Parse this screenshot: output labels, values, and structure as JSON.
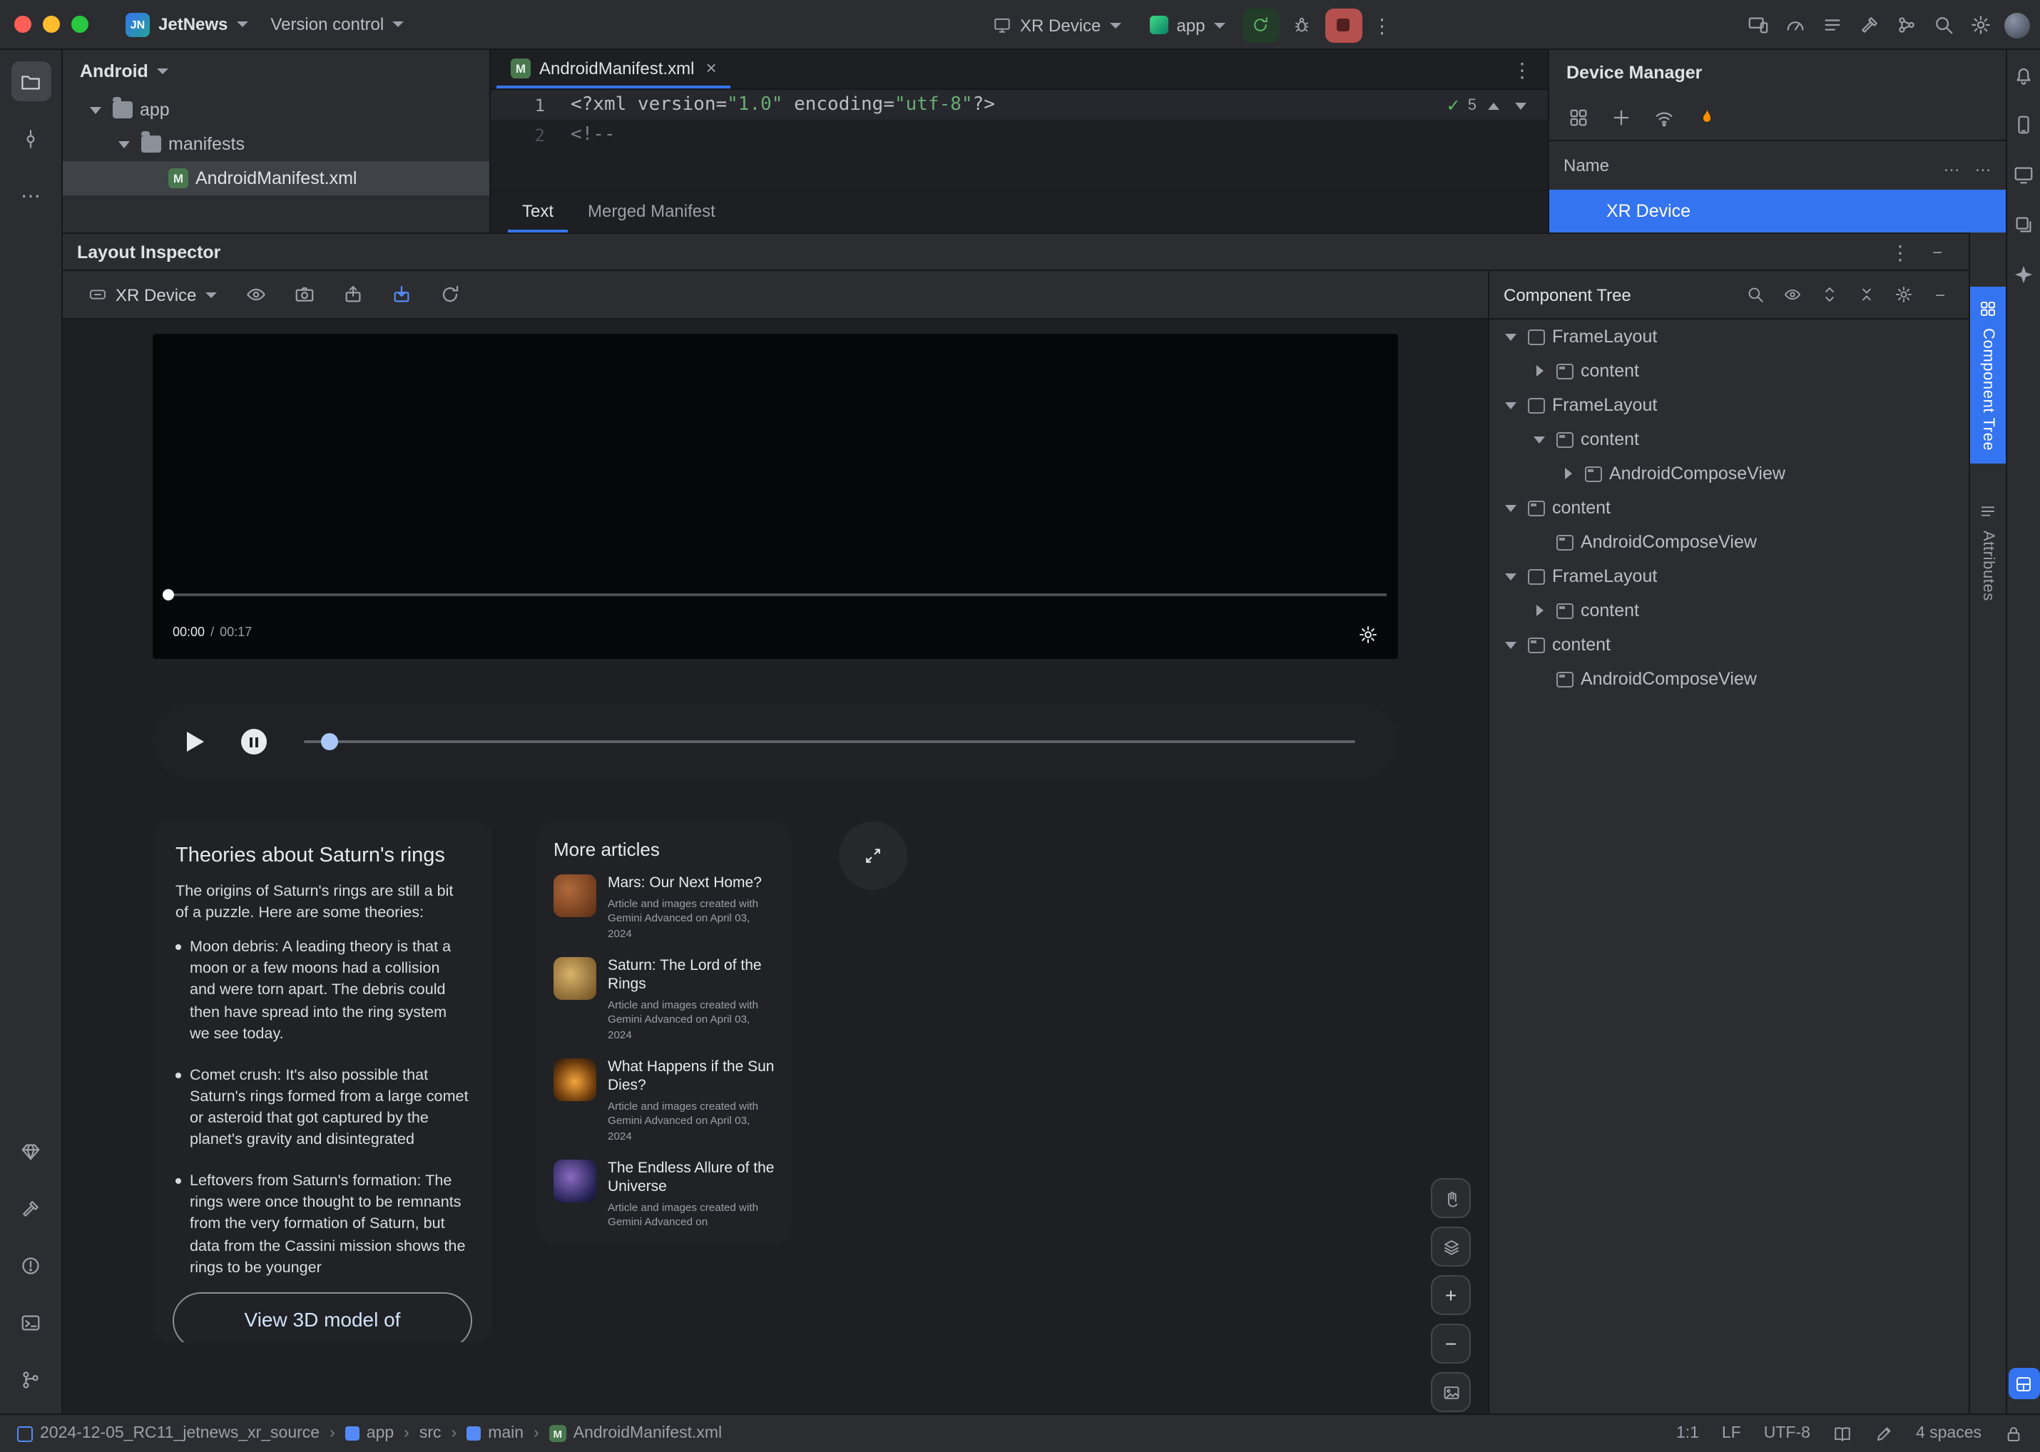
{
  "colors": {
    "accent": "#3574F0",
    "run_green": "#5FB865",
    "stop_red": "#B4504D",
    "string_green": "#6AAB73",
    "firebase_orange": "#FF8F00",
    "selection_blue": "#3574F0"
  },
  "icons": {
    "kebab": "⋮",
    "meatball": "⋯",
    "close": "×",
    "manifest_badge": "M",
    "check": "✓",
    "breadcrumb_separator": "›",
    "plus": "+",
    "minus": "−"
  },
  "titlebar": {
    "app_badge": "JN",
    "project_name": "JetNews",
    "vcs_label": "Version control",
    "device_selector": "XR Device",
    "run_config": "app"
  },
  "project_panel": {
    "title": "Android",
    "nodes": [
      {
        "label": "app"
      },
      {
        "label": "manifests"
      },
      {
        "label": "AndroidManifest.xml"
      }
    ]
  },
  "editor": {
    "tab_title": "AndroidManifest.xml",
    "inspections_count": "5",
    "lines": [
      {
        "num": "1",
        "tokens": [
          {
            "text": "<?xml version="
          },
          {
            "text": "\"1.0\""
          },
          {
            "text": " encoding="
          },
          {
            "text": "\"utf-8\""
          },
          {
            "text": "?>"
          }
        ]
      },
      {
        "num": "2",
        "tokens": [
          {
            "text": "<!--"
          }
        ]
      }
    ],
    "bottom_tabs": [
      {
        "label": "Text"
      },
      {
        "label": "Merged Manifest"
      }
    ]
  },
  "device_manager": {
    "title": "Device Manager",
    "name_column": "Name",
    "col_more_1": "…",
    "col_more_2": "…",
    "selected_device": "XR Device"
  },
  "layout_inspector": {
    "title": "Layout Inspector",
    "device_selector": "XR Device",
    "video": {
      "elapsed": "00:00",
      "separator": "/",
      "duration": "00:17"
    },
    "theories_card": {
      "title": "Theories about Saturn's rings",
      "intro": "The origins of Saturn's rings are still a bit of a puzzle. Here are some theories:",
      "bullets": [
        {
          "text": "Moon debris: A leading theory is that a moon or a few moons had a collision and were torn apart. The debris could then have spread into the ring system we see today."
        },
        {
          "text": "Comet crush: It's also possible that Saturn's rings formed from a large comet or asteroid that got captured by the planet's gravity and disintegrated"
        },
        {
          "text": "Leftovers from Saturn's formation: The rings were once thought to be remnants from the very formation of Saturn, but data from the Cassini mission shows the rings to be younger"
        }
      ],
      "cut_button_label": "View 3D model of"
    },
    "articles_card": {
      "title": "More articles",
      "articles": [
        {
          "title": "Mars: Our Next Home?",
          "subtitle": "Article and images created with Gemini Advanced on April 03, 2024"
        },
        {
          "title": "Saturn: The Lord of the Rings",
          "subtitle": "Article and images created with Gemini Advanced on April 03, 2024"
        },
        {
          "title": "What Happens if the Sun Dies?",
          "subtitle": "Article and images created with Gemini Advanced on April 03, 2024"
        },
        {
          "title": "The Endless Allure of the Universe",
          "subtitle": "Article and images created with Gemini Advanced on"
        }
      ]
    }
  },
  "component_tree": {
    "title": "Component Tree",
    "nodes": [
      {
        "label": "FrameLayout"
      },
      {
        "label": "content"
      },
      {
        "label": "FrameLayout"
      },
      {
        "label": "content"
      },
      {
        "label": "AndroidComposeView"
      },
      {
        "label": "content"
      },
      {
        "label": "AndroidComposeView"
      },
      {
        "label": "FrameLayout"
      },
      {
        "label": "content"
      },
      {
        "label": "content"
      },
      {
        "label": "AndroidComposeView"
      }
    ],
    "side_tabs": [
      {
        "label": "Component Tree"
      },
      {
        "label": "Attributes"
      }
    ]
  },
  "status_bar": {
    "breadcrumbs": [
      {
        "label": "2024-12-05_RC11_jetnews_xr_source"
      },
      {
        "label": "app"
      },
      {
        "label": "src"
      },
      {
        "label": "main"
      },
      {
        "label": "AndroidManifest.xml"
      }
    ],
    "caret_position": "1:1",
    "line_separator": "LF",
    "encoding": "UTF-8",
    "indent": "4 spaces"
  }
}
